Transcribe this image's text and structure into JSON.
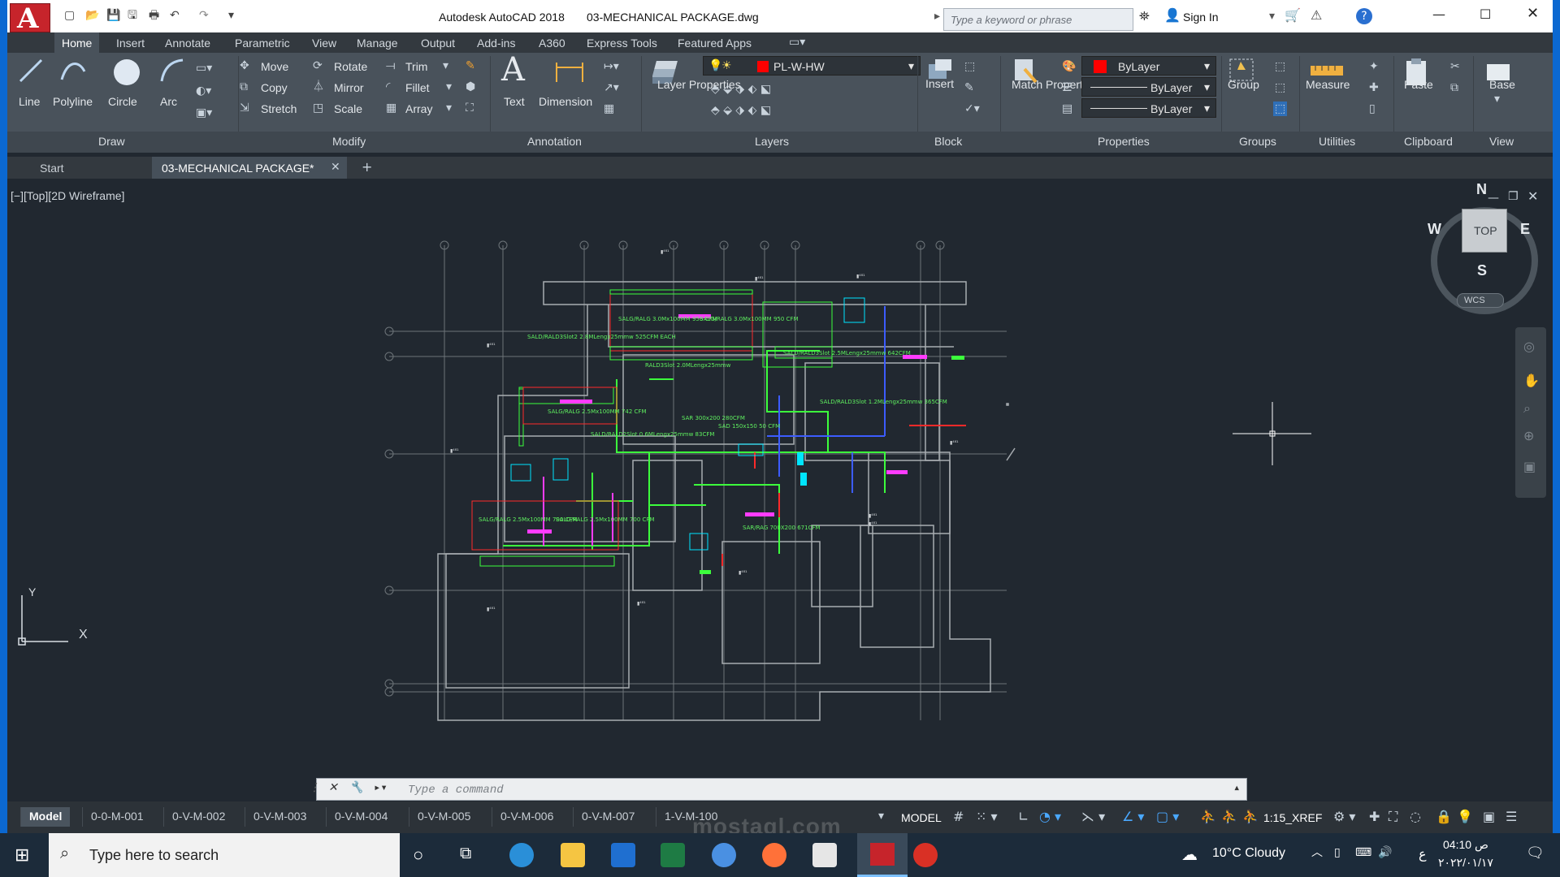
{
  "title": {
    "app_name": "Autodesk AutoCAD 2018",
    "doc_name": "03-MECHANICAL PACKAGE.dwg",
    "search_placeholder": "Type a keyword or phrase",
    "sign_in": "Sign In",
    "brand_logo": "A"
  },
  "ribbon_tabs": [
    "Home",
    "Insert",
    "Annotate",
    "Parametric",
    "View",
    "Manage",
    "Output",
    "Add-ins",
    "A360",
    "Express Tools",
    "Featured Apps"
  ],
  "draw": {
    "line": "Line",
    "polyline": "Polyline",
    "circle": "Circle",
    "arc": "Arc",
    "group": "Draw"
  },
  "modify": {
    "move": "Move",
    "rotate": "Rotate",
    "trim": "Trim",
    "copy": "Copy",
    "mirror": "Mirror",
    "fillet": "Fillet",
    "stretch": "Stretch",
    "scale": "Scale",
    "array": "Array",
    "group": "Modify"
  },
  "annotation": {
    "text": "Text",
    "dimension": "Dimension",
    "group": "Annotation"
  },
  "layers": {
    "layer_properties": "Layer Properties",
    "current_layer": "PL-W-HW",
    "group": "Layers"
  },
  "block": {
    "insert": "Insert",
    "group": "Block"
  },
  "properties": {
    "match": "Match Properties",
    "color": "ByLayer",
    "linetype": "ByLayer",
    "lineweight": "ByLayer",
    "group": "Properties"
  },
  "groups": {
    "group": "Group",
    "panel": "Groups"
  },
  "utilities": {
    "measure": "Measure",
    "panel": "Utilities"
  },
  "clipboard": {
    "paste": "Paste",
    "panel": "Clipboard"
  },
  "view_panel": {
    "base": "Base",
    "panel": "View"
  },
  "doc_tabs": {
    "start": "Start",
    "active": "03-MECHANICAL PACKAGE*"
  },
  "viewport": {
    "label": "[−][Top][2D Wireframe]",
    "compass": {
      "n": "N",
      "s": "S",
      "e": "E",
      "w": "W",
      "top": "TOP",
      "wcs": "WCS"
    },
    "ucs_y": "Y",
    "ucs_x": "X"
  },
  "drawing": {
    "labels": [
      {
        "text": "SALG/RALG 3.0Mx100MM 950 CFM"
      },
      {
        "text": "SALG/RALG 3.0Mx100MM 950 CFM"
      },
      {
        "text": "SALD/RALD3Slot2 2.8MLengx25mmw 525CFM EACH"
      },
      {
        "text": "RALD3Slot 2.0MLengx25mmw"
      },
      {
        "text": "SALD/RALD3Slot 2.5MLengx25mmw 642CFM"
      },
      {
        "text": "SALG/RALG 2.5Mx100MM 742 CFM"
      },
      {
        "text": "SALD/RALD2Slot 0.6MLengx25mmw 83CFM"
      },
      {
        "text": "SAR 300x200 280CFM"
      },
      {
        "text": "SALD/RALD3Slot 1.2MLengx25mmw 365CFM"
      },
      {
        "text": "SAD 150x150 50 CFM"
      },
      {
        "text": "SALG/RALG 2.5Mx100MM 700 CFM"
      },
      {
        "text": "SALG/RALG 2.5Mx100MM 700 CFM"
      },
      {
        "text": "SAR/RAG 700X200 671CFM"
      }
    ]
  },
  "command": {
    "placeholder": "Type a command"
  },
  "layout_tabs": [
    "Model",
    "0-0-M-001",
    "0-V-M-002",
    "0-V-M-003",
    "0-V-M-004",
    "0-V-M-005",
    "0-V-M-006",
    "0-V-M-007",
    "1-V-M-100"
  ],
  "status": {
    "model": "MODEL",
    "scale": "1:15_XREF"
  },
  "taskbar": {
    "search_placeholder": "Type here to search",
    "weather": "10°C  Cloudy",
    "time": "04:10 ص",
    "date": "٢٠٢٢/٠١/١٧",
    "lang": "ع"
  },
  "watermark": "mostaql.com",
  "colors": {
    "accent": "#c6242b",
    "ribbon": "#49525b",
    "canvas": "#212830",
    "duct_green": "#3cff3c"
  }
}
